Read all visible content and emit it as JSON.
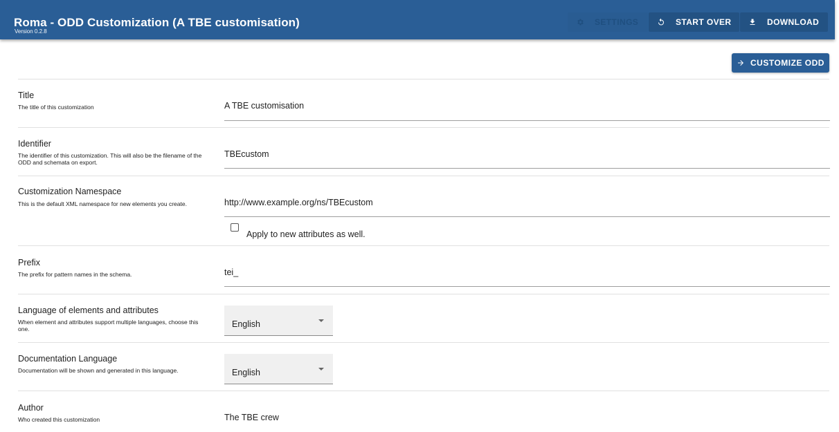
{
  "header": {
    "title": "Roma - ODD Customization (A TBE customisation)",
    "version": "Version 0.2.8",
    "settings_label": "SETTINGS",
    "start_over_label": "START OVER",
    "download_label": "DOWNLOAD"
  },
  "toolbar": {
    "customize_label": "CUSTOMIZE ODD"
  },
  "fields": {
    "title": {
      "label": "Title",
      "help": "The title of this customization",
      "value": "A TBE customisation"
    },
    "identifier": {
      "label": "Identifier",
      "help": "The identifier of this customization. This will also be the filename of the ODD and schemata on export.",
      "value": "TBEcustom"
    },
    "namespace": {
      "label": "Customization Namespace",
      "help": "This is the default XML namespace for new elements you create.",
      "value": "http://www.example.org/ns/TBEcustom",
      "checkbox_label": "Apply to new attributes as well."
    },
    "prefix": {
      "label": "Prefix",
      "help": "The prefix for pattern names in the schema.",
      "value": "tei_"
    },
    "language": {
      "label": "Language of elements and attributes",
      "help": "When element and attributes support multiple languages, choose this one.",
      "value": "English"
    },
    "doc_language": {
      "label": "Documentation Language",
      "help": "Documentation will be shown and generated in this language.",
      "value": "English"
    },
    "author": {
      "label": "Author",
      "help": "Who created this customization",
      "value": "The TBE crew"
    }
  },
  "colors": {
    "primary": "#2a5e96",
    "primary_dark": "#235283"
  }
}
